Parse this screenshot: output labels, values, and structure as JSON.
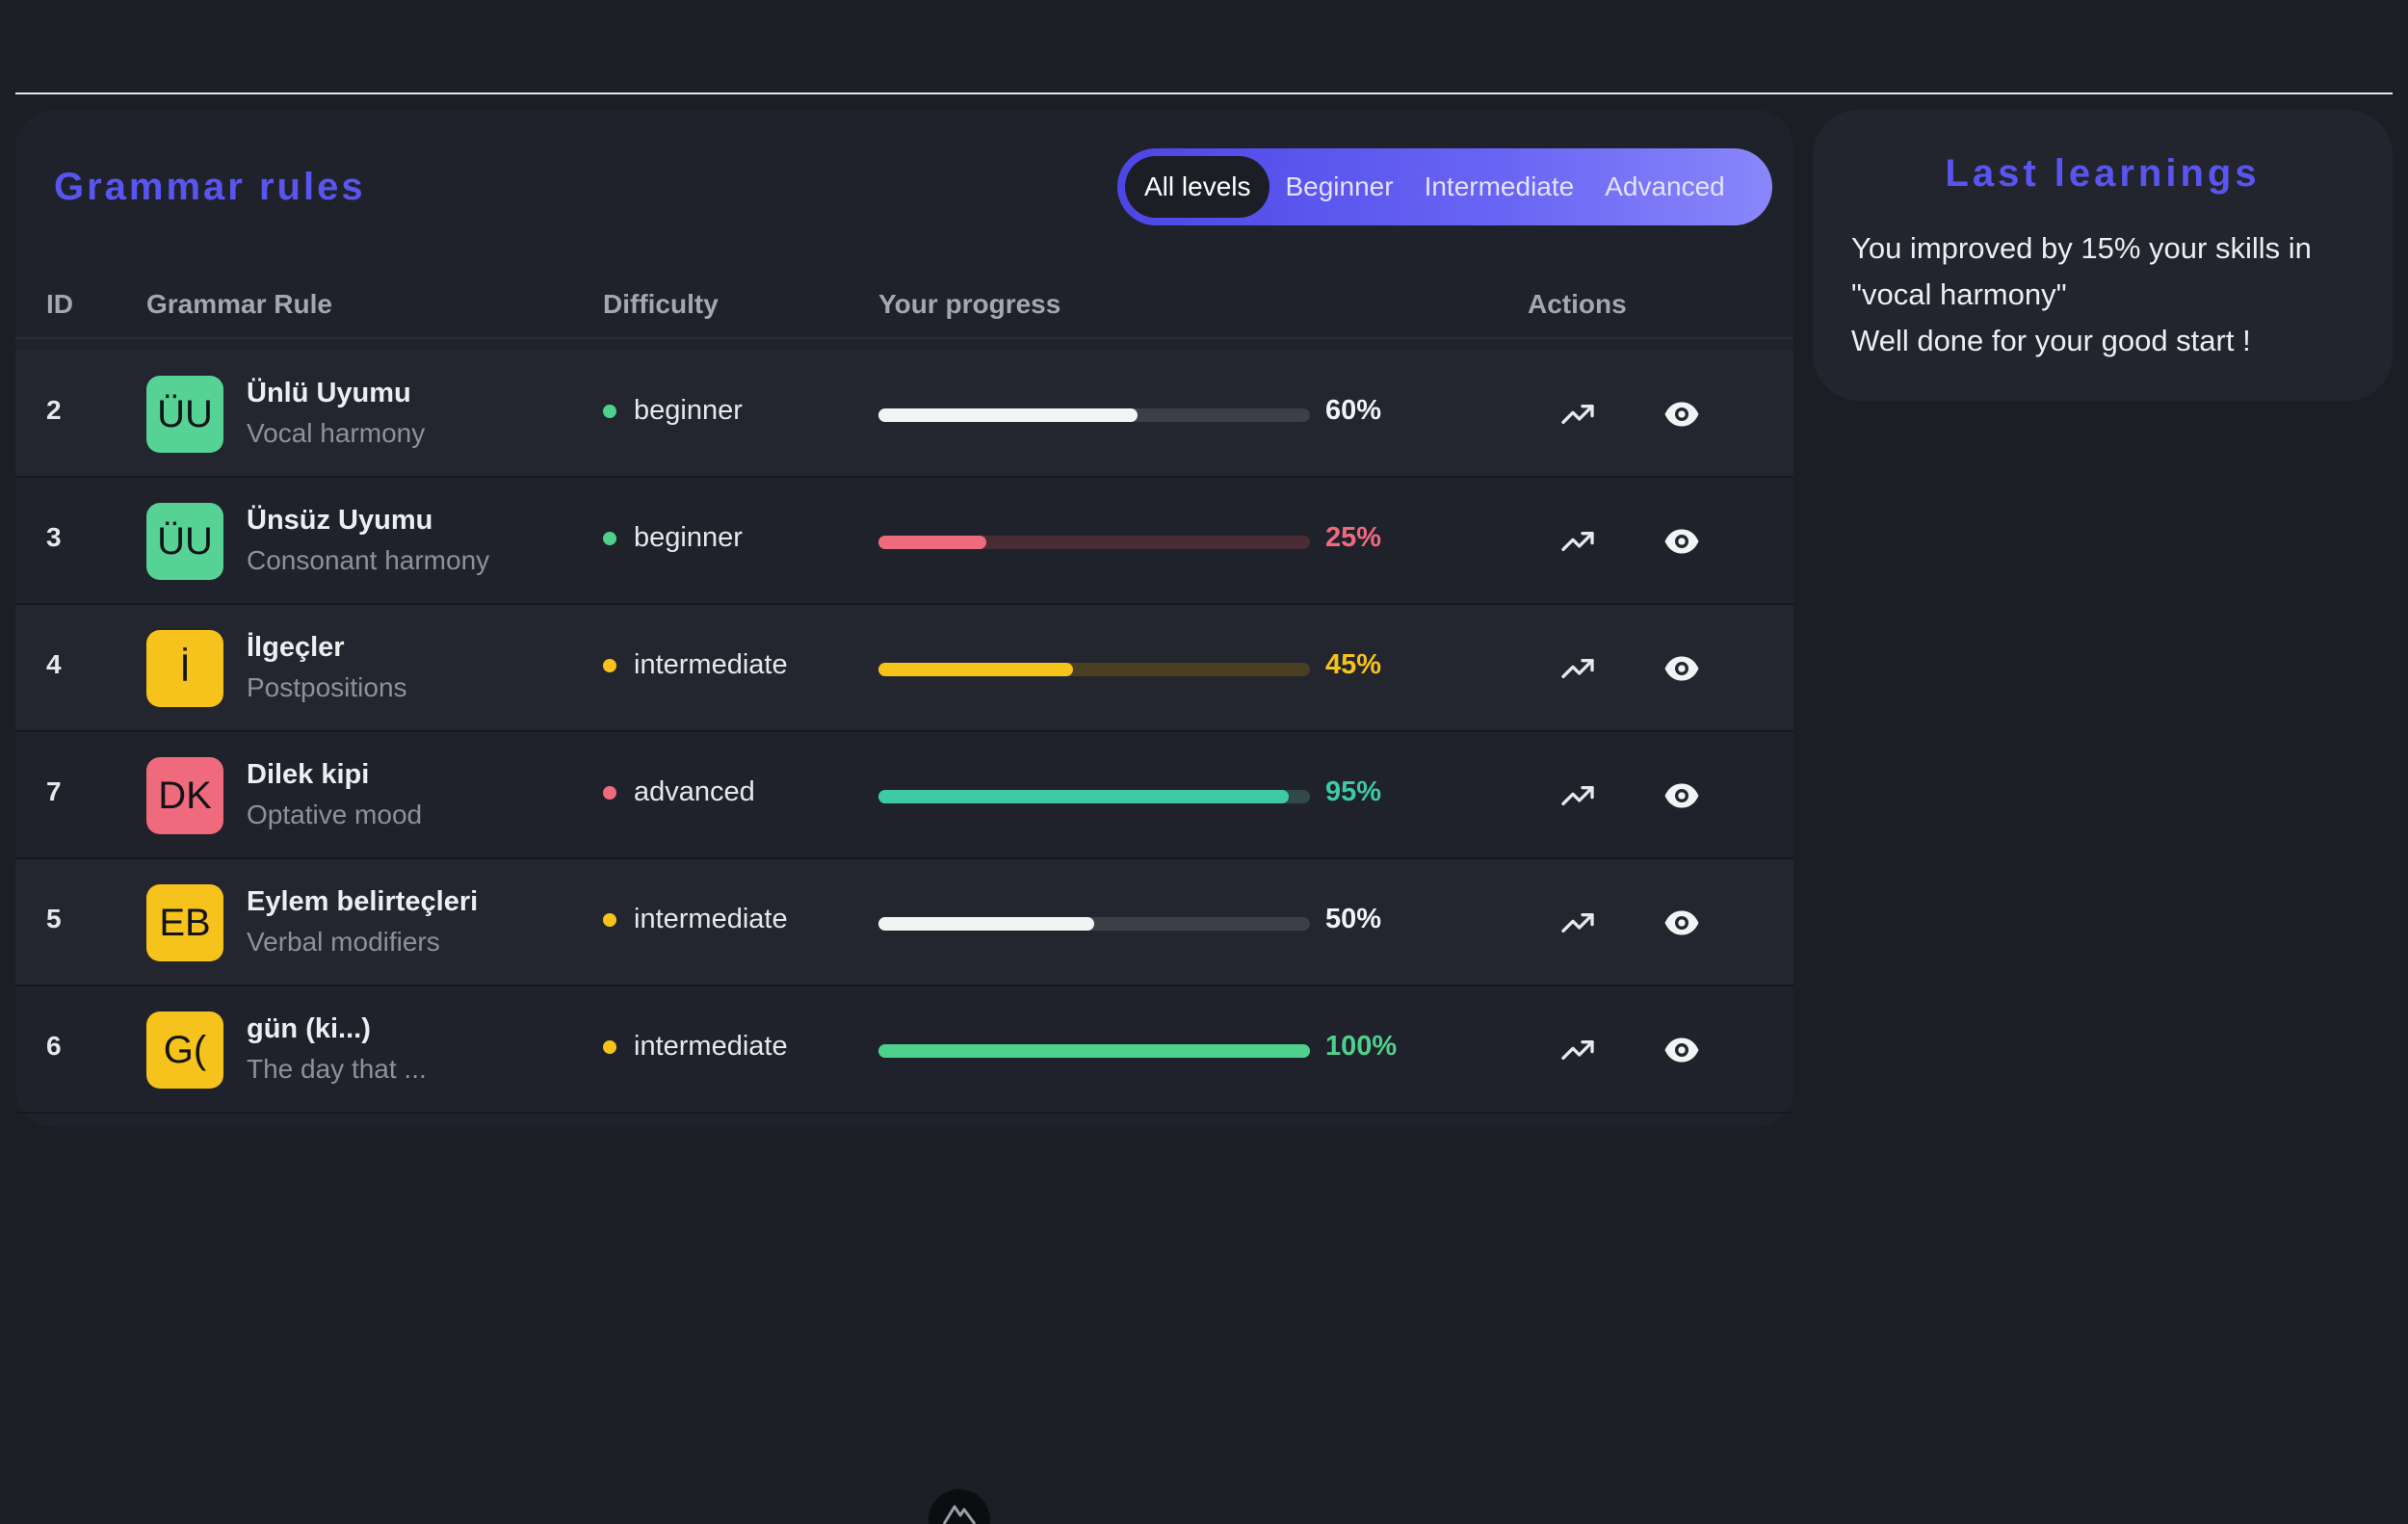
{
  "grammar": {
    "title": "Grammar rules",
    "levels": [
      "All levels",
      "Beginner",
      "Intermediate",
      "Advanced"
    ],
    "active_level": "All levels",
    "columns": {
      "id": "ID",
      "rule": "Grammar Rule",
      "difficulty": "Difficulty",
      "progress": "Your progress",
      "actions": "Actions"
    },
    "rows": [
      {
        "id": "2",
        "initials": "ÜU",
        "avatar_color": "#56d394",
        "name": "Ünlü Uyumu",
        "subtitle": "Vocal harmony",
        "difficulty": "beginner",
        "dot_color": "#4fd08c",
        "progress": 60,
        "progress_label": "60%",
        "bar_color": "#f2f3f5",
        "track_color": "#3c3f46",
        "pct_color": "#f2f3f5",
        "trend_icon": "trending-up-icon",
        "view_icon": "eye-icon"
      },
      {
        "id": "3",
        "initials": "ÜU",
        "avatar_color": "#56d394",
        "name": "Ünsüz Uyumu",
        "subtitle": "Consonant harmony",
        "difficulty": "beginner",
        "dot_color": "#4fd08c",
        "progress": 25,
        "progress_label": "25%",
        "bar_color": "#f06a7e",
        "track_color": "#4a2d34",
        "pct_color": "#f06a7e",
        "trend_icon": "trending-up-icon",
        "view_icon": "eye-icon"
      },
      {
        "id": "4",
        "initials": "İ",
        "avatar_color": "#f6c21c",
        "name": "İlgeçler",
        "subtitle": "Postpositions",
        "difficulty": "intermediate",
        "dot_color": "#f6c21c",
        "progress": 45,
        "progress_label": "45%",
        "bar_color": "#f6c21c",
        "track_color": "#4a3f22",
        "pct_color": "#f6c21c",
        "trend_icon": "trending-up-icon",
        "view_icon": "eye-icon"
      },
      {
        "id": "7",
        "initials": "DK",
        "avatar_color": "#f06a7e",
        "name": "Dilek kipi",
        "subtitle": "Optative mood",
        "difficulty": "advanced",
        "dot_color": "#f06a7e",
        "progress": 95,
        "progress_label": "95%",
        "bar_color": "#3ec9a7",
        "track_color": "#2f4a47",
        "pct_color": "#3ec9a7",
        "trend_icon": "trending-up-icon",
        "view_icon": "eye-icon"
      },
      {
        "id": "5",
        "initials": "EB",
        "avatar_color": "#f6c21c",
        "name": "Eylem belirteçleri",
        "subtitle": "Verbal modifiers",
        "difficulty": "intermediate",
        "dot_color": "#f6c21c",
        "progress": 50,
        "progress_label": "50%",
        "bar_color": "#f2f3f5",
        "track_color": "#3c3f46",
        "pct_color": "#f2f3f5",
        "trend_icon": "trending-up-icon",
        "view_icon": "eye-icon"
      },
      {
        "id": "6",
        "initials": "G(",
        "avatar_color": "#f6c21c",
        "name": "gün (ki...)",
        "subtitle": "The day that ...",
        "difficulty": "intermediate",
        "dot_color": "#f6c21c",
        "progress": 100,
        "progress_label": "100%",
        "bar_color": "#4fd08c",
        "track_color": "#2d4a3a",
        "pct_color": "#4fd08c",
        "trend_icon": "trending-up-icon",
        "view_icon": "eye-icon"
      }
    ]
  },
  "last_learnings": {
    "title": "Last learnings",
    "lines": [
      "You improved by 15% your skills in \"vocal harmony\"",
      "Well done for your good start !"
    ]
  },
  "footer": {
    "logo_icon": "mountain-logo-icon"
  }
}
